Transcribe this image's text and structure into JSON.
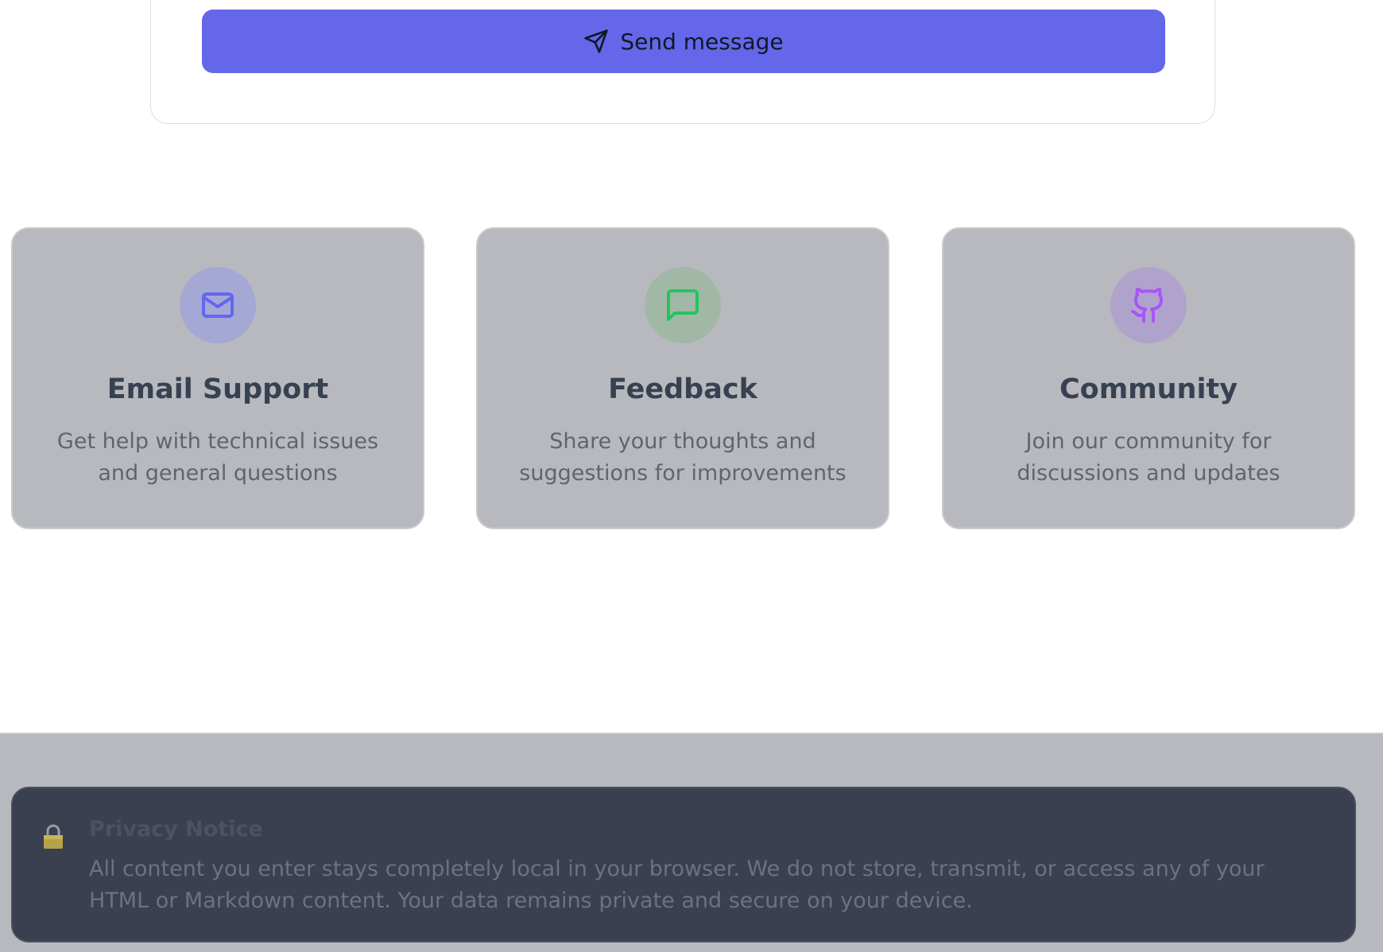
{
  "form": {
    "send_label": "Send message"
  },
  "cards": [
    {
      "icon": "mail-icon",
      "title": "Email Support",
      "description": "Get help with technical issues and general questions",
      "accent": "#6366f1"
    },
    {
      "icon": "message-square-icon",
      "title": "Feedback",
      "description": "Share your thoughts and suggestions for improvements",
      "accent": "#22c55e"
    },
    {
      "icon": "github-icon",
      "title": "Community",
      "description": "Join our community for discussions and updates",
      "accent": "#a855f7"
    }
  ],
  "privacy": {
    "icon": "lock-icon",
    "title": "Privacy Notice",
    "text": "All content you enter stays completely local in your browser. We do not store, transmit, or access any of your HTML or Markdown content. Your data remains private and secure on your device."
  },
  "colors": {
    "primary": "#6467e9",
    "overlay": "#b8b9be",
    "privacy_bg": "#3a4050"
  }
}
